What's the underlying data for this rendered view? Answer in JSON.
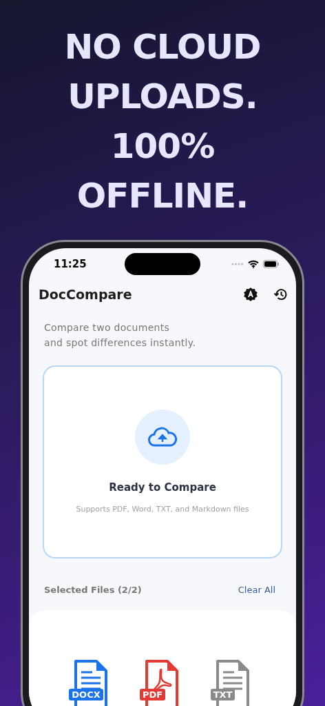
{
  "headline": [
    "NO CLOUD",
    "UPLOADS.",
    "100%",
    "OFFLINE."
  ],
  "status_bar": {
    "time": "11:25"
  },
  "app_bar": {
    "title": "DocCompare"
  },
  "intro": [
    "Compare two documents",
    "and spot differences instantly."
  ],
  "drop_zone": {
    "title": "Ready to Compare",
    "subtitle": "Supports PDF, Word, TXT, and Markdown files"
  },
  "selected_files": {
    "label": "Selected Files (2/2)",
    "action": "Clear All"
  },
  "file_types": [
    {
      "kind": "doc",
      "label": "DOCX",
      "color": "#1a73e8"
    },
    {
      "kind": "pdf",
      "label": "PDF",
      "color": "#e53935"
    },
    {
      "kind": "doc",
      "label": "TXT",
      "color": "#8a8a8a"
    }
  ]
}
